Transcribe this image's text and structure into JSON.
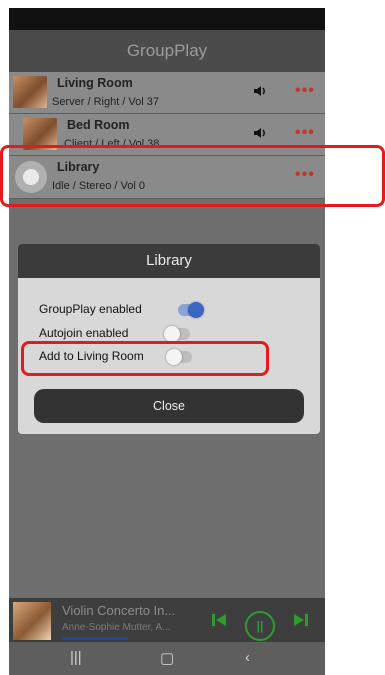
{
  "app": {
    "title": "GroupPlay"
  },
  "rooms": [
    {
      "name": "Living Room",
      "status": "Server / Right / Vol 37",
      "volume_icon": "speaker-icon",
      "more_icon": "more-dots-icon"
    },
    {
      "name": "Bed Room",
      "status": "Client / Left / Vol 38",
      "volume_icon": "speaker-icon",
      "more_icon": "more-dots-icon"
    },
    {
      "name": "Library",
      "status": "Idle / Stereo / Vol 0",
      "more_icon": "more-dots-icon"
    }
  ],
  "dialog": {
    "title": "Library",
    "settings": [
      {
        "label": "GroupPlay enabled",
        "enabled": true
      },
      {
        "label": "Autojoin enabled",
        "enabled": false
      },
      {
        "label": "Add to Living Room",
        "enabled": false
      }
    ],
    "close_label": "Close"
  },
  "player": {
    "track": "Violin Concerto In...",
    "artist": "Anne-Sophie Mutter, A...",
    "prev_icon": "skip-previous-icon",
    "pause_icon": "pause-icon",
    "next_icon": "skip-next-icon"
  },
  "navbar": {
    "icons": [
      "recent-apps-icon",
      "home-icon",
      "back-icon"
    ]
  },
  "colors": {
    "highlight": "#e31b1b",
    "accent": "#3c66c4",
    "player_controls": "#2f9c2f",
    "more_dots": "#c0392b"
  }
}
